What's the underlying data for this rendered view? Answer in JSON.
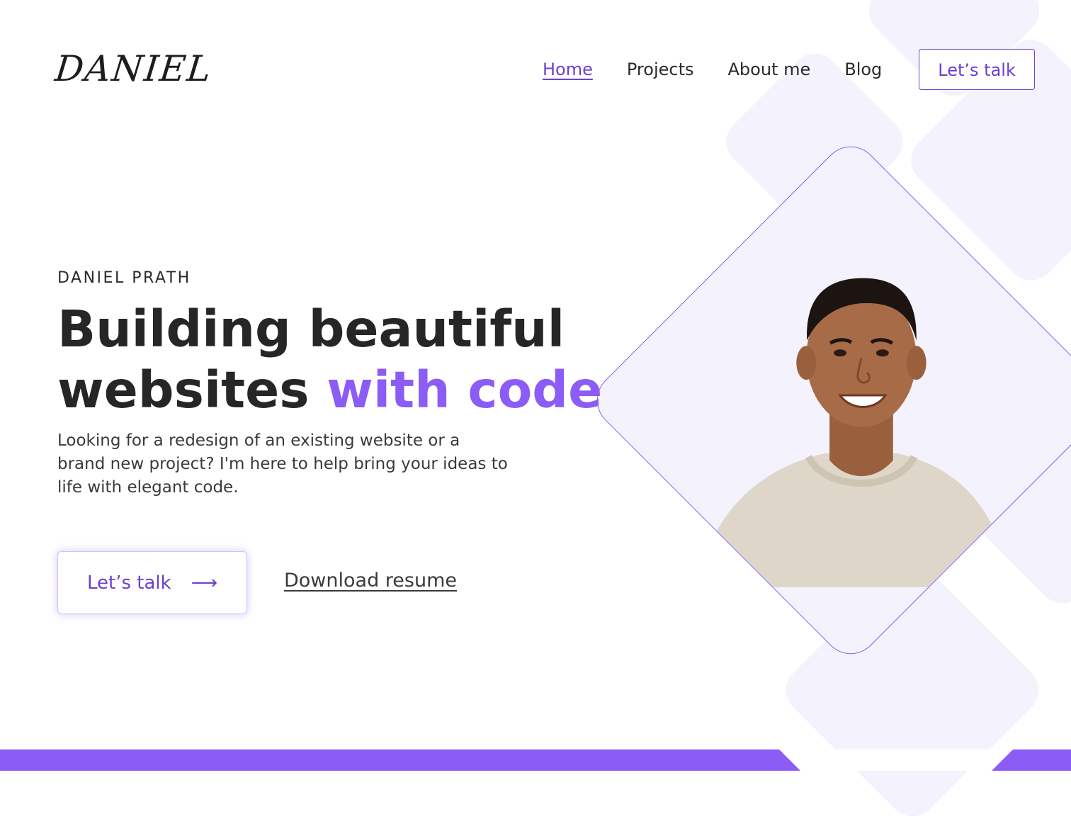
{
  "brand": {
    "logo_text": "DANIEL"
  },
  "nav": {
    "items": [
      {
        "label": "Home",
        "active": true
      },
      {
        "label": "Projects",
        "active": false
      },
      {
        "label": "About me",
        "active": false
      },
      {
        "label": "Blog",
        "active": false
      }
    ],
    "cta_label": "Let’s talk"
  },
  "hero": {
    "eyebrow": "DANIEL PRATH",
    "headline_line1": "Building beautiful",
    "headline_line2_plain": "websites",
    "headline_line2_accent": "with code",
    "lede": "Looking for a redesign of an existing website or a brand new project? I'm here to help bring your ideas to life with elegant code.",
    "primary_cta": "Let’s talk",
    "primary_cta_arrow": "⟶",
    "secondary_cta": "Download resume"
  },
  "colors": {
    "accent": "#8b5cf6",
    "accent_dark": "#6d3fd3",
    "tile": "#f4f2fd",
    "text": "#262626"
  },
  "icons": {
    "cta_arrow": "arrow-right-icon"
  }
}
